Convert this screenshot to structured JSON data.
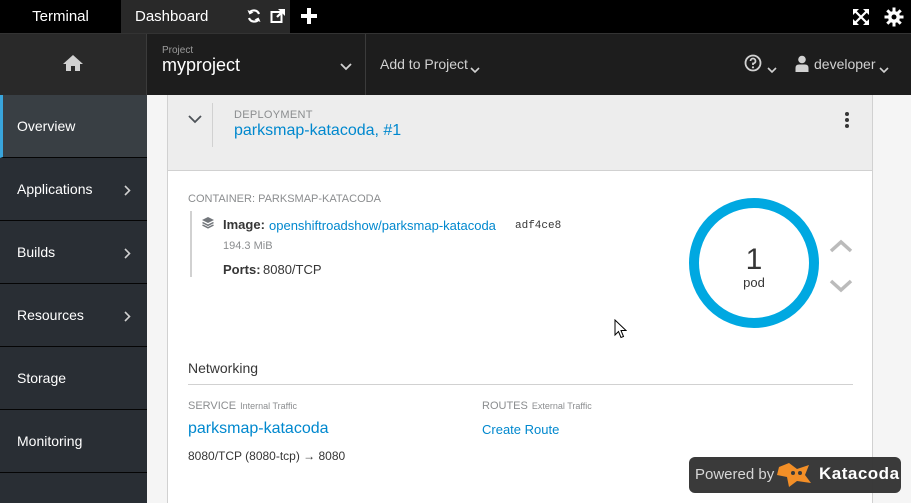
{
  "tabs": {
    "terminal": "Terminal",
    "dashboard": "Dashboard"
  },
  "masthead": {
    "project_label": "Project",
    "project_name": "myproject",
    "add_to_project": "Add to Project",
    "user": "developer"
  },
  "sidebar": {
    "items": [
      {
        "label": "Overview",
        "active": true,
        "has_submenu": false
      },
      {
        "label": "Applications",
        "active": false,
        "has_submenu": true
      },
      {
        "label": "Builds",
        "active": false,
        "has_submenu": true
      },
      {
        "label": "Resources",
        "active": false,
        "has_submenu": true
      },
      {
        "label": "Storage",
        "active": false,
        "has_submenu": false
      },
      {
        "label": "Monitoring",
        "active": false,
        "has_submenu": false
      }
    ]
  },
  "deployment": {
    "label": "DEPLOYMENT",
    "name": "parksmap-katacoda, #1"
  },
  "container": {
    "label": "CONTAINER: PARKSMAP-KATACODA",
    "image_label": "Image:",
    "image_link": "openshiftroadshow/parksmap-katacoda",
    "image_hash": "adf4ce8",
    "image_size": "194.3 MiB",
    "ports_label": "Ports:",
    "ports_value": "8080/TCP"
  },
  "pods": {
    "count": "1",
    "unit": "pod"
  },
  "networking": {
    "title": "Networking",
    "service_label": "SERVICE",
    "service_sub": "Internal Traffic",
    "service_name": "parksmap-katacoda",
    "service_ports": "8080/TCP (8080-tcp) → 8080",
    "routes_label": "ROUTES",
    "routes_sub": "External Traffic",
    "create_route": "Create Route"
  },
  "powered_by": {
    "text": "Powered by",
    "brand": "Katacoda"
  },
  "colors": {
    "accent": "#0088ce",
    "donut": "#00a8e1",
    "nav_active_border": "#39a5dc",
    "sidebar_bg": "#292e34"
  }
}
